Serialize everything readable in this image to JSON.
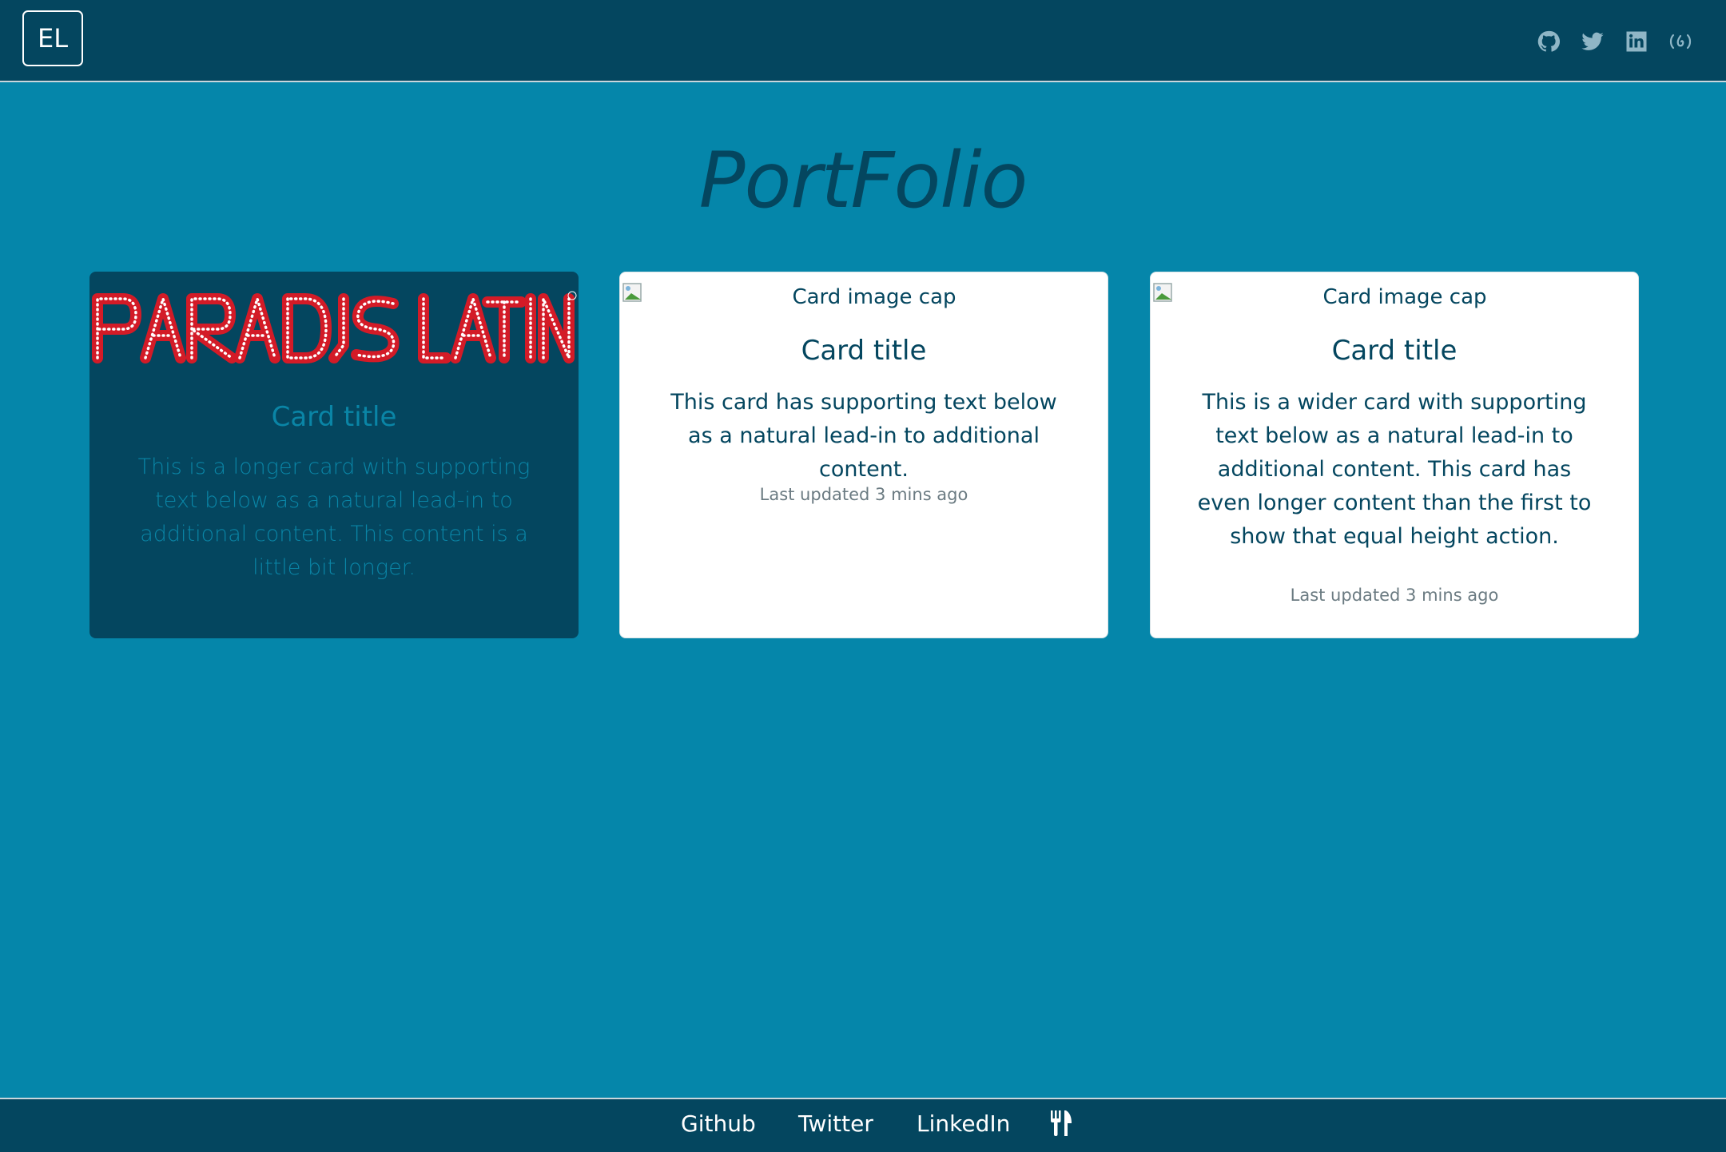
{
  "header": {
    "brand": "EL",
    "social_icons": [
      "github-icon",
      "twitter-icon",
      "linkedin-icon",
      "freecodecamp-icon"
    ]
  },
  "page": {
    "title": "PortFolio"
  },
  "cards": [
    {
      "logo_text": "PARADIS LATIN",
      "title": "Card title",
      "text": "This is a longer card with supporting text below as a natural lead-in to additional content. This content is a little bit longer."
    },
    {
      "image_alt": "Card image cap",
      "title": "Card title",
      "text": "This card has supporting text below as a natural lead-in to additional content.",
      "updated": "Last updated 3 mins ago"
    },
    {
      "image_alt": "Card image cap",
      "title": "Card title",
      "text": "This is a wider card with supporting text below as a natural lead-in to additional content. This card has even longer content than the first to show that equal height action.",
      "updated": "Last updated 3 mins ago"
    }
  ],
  "footer": {
    "links": [
      "Github",
      "Twitter",
      "LinkedIn"
    ],
    "extra_icon": "fork-knife-icon"
  },
  "colors": {
    "background": "#0586aa",
    "nav": "#04465f",
    "dark_card_text": "#0a85a6",
    "light_card_text": "#04465f"
  }
}
